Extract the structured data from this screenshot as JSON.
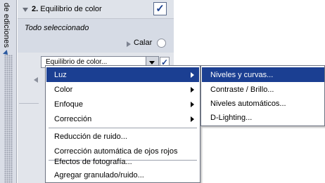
{
  "side_tab": {
    "label": "de ediciones"
  },
  "step": {
    "number": "2.",
    "title": "Equilibrio de color",
    "checked_mark": "✓",
    "selection_text": "Todo seleccionado",
    "calar_label": "Calar"
  },
  "sub_step": {
    "combo_value": "Equilibrio de color...",
    "checked_mark": "✓"
  },
  "menu": {
    "items": [
      {
        "label": "Luz",
        "has_submenu": true,
        "highlighted": true
      },
      {
        "label": "Color",
        "has_submenu": true,
        "highlighted": false
      },
      {
        "label": "Enfoque",
        "has_submenu": true,
        "highlighted": false
      },
      {
        "label": "Corrección",
        "has_submenu": true,
        "highlighted": false
      },
      {
        "label": "Reducción de ruido...",
        "has_submenu": false,
        "highlighted": false
      },
      {
        "label": "Corrección automática de ojos rojos",
        "has_submenu": false,
        "highlighted": false
      },
      {
        "label": "Efectos de fotografía...",
        "has_submenu": false,
        "highlighted": false
      },
      {
        "label": "Agregar granulado/ruido...",
        "has_submenu": false,
        "highlighted": false
      }
    ]
  },
  "submenu": {
    "items": [
      {
        "label": "Niveles y curvas...",
        "highlighted": true
      },
      {
        "label": "Contraste / Brillo...",
        "highlighted": false
      },
      {
        "label": "Niveles automáticos...",
        "highlighted": false
      },
      {
        "label": "D-Lighting...",
        "highlighted": false
      }
    ]
  },
  "colors": {
    "highlight": "#1b3f92",
    "panel": "#e9ebef"
  }
}
